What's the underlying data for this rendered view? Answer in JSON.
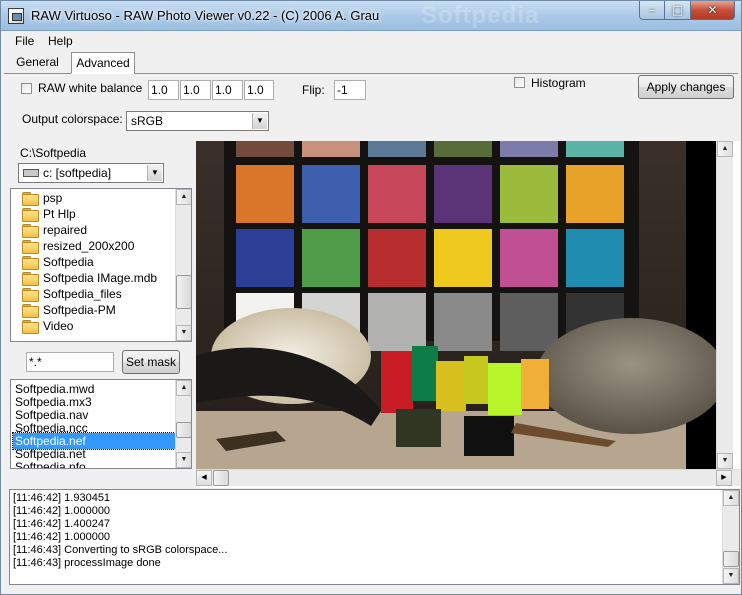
{
  "window": {
    "title": "RAW Virtuoso  -  RAW Photo Viewer v0.22 - (C) 2006 A. Grau",
    "watermark": "Softpedia",
    "min_glyph": "–",
    "max_glyph": "□",
    "close_glyph": "✕"
  },
  "menu": {
    "items": [
      "File",
      "Help"
    ]
  },
  "tabs": {
    "general": "General",
    "advanced": "Advanced",
    "active": "Advanced"
  },
  "settings": {
    "raw_white_balance_label": "RAW white balance",
    "raw_white_balance_checked": false,
    "wb_values": [
      "1.0",
      "1.0",
      "1.0",
      "1.0"
    ],
    "flip_label": "Flip:",
    "flip_value": "-1",
    "histogram_label": "Histogram",
    "histogram_checked": false,
    "apply_button": "Apply changes",
    "output_colorspace_label": "Output colorspace:",
    "output_colorspace_value": "sRGB"
  },
  "browser": {
    "path": "C:\\Softpedia",
    "drive": "c: [softpedia]",
    "folders": [
      "psp",
      "Pt Hlp",
      "repaired",
      "resized_200x200",
      "Softpedia",
      "Softpedia IMage.mdb",
      "Softpedia_files",
      "Softpedia-PM",
      "Video"
    ],
    "mask_value": "*.*",
    "set_mask_button": "Set mask",
    "files": [
      "Softpedia.mwd",
      "Softpedia.mx3",
      "Softpedia.nav",
      "Softpedia.ncc",
      "Softpedia.nef",
      "Softpedia.net",
      "Softpedia.nfo"
    ],
    "selected_file": "Softpedia.nef"
  },
  "viewer": {
    "chart_colors": [
      "#d9762a",
      "#3d5fae",
      "#c9475a",
      "#5a3476",
      "#9cbb3c",
      "#e8a229",
      "#2b3f96",
      "#4f9d48",
      "#b82e2e",
      "#f0c91e",
      "#c04f93",
      "#1f8cb0",
      "#f2f2ef",
      "#d4d4d2",
      "#b1b1b0",
      "#8a8a8a",
      "#5e5e5e",
      "#333333"
    ],
    "top_row_colors": [
      "#734a3b",
      "#c7917b",
      "#5b7897",
      "#586c3a",
      "#7d7ba9",
      "#5ab4a7"
    ]
  },
  "log": {
    "lines": [
      "[11:46:42]  1.930451",
      "[11:46:42]  1.000000",
      "[11:46:42]  1.400247",
      "[11:46:42]  1.000000",
      "[11:46:43] Converting to sRGB colorspace...",
      "[11:46:43] processImage done"
    ]
  },
  "scroll_glyphs": {
    "up": "▲",
    "down": "▼",
    "left": "◀",
    "right": "▶",
    "combo": "▼"
  }
}
